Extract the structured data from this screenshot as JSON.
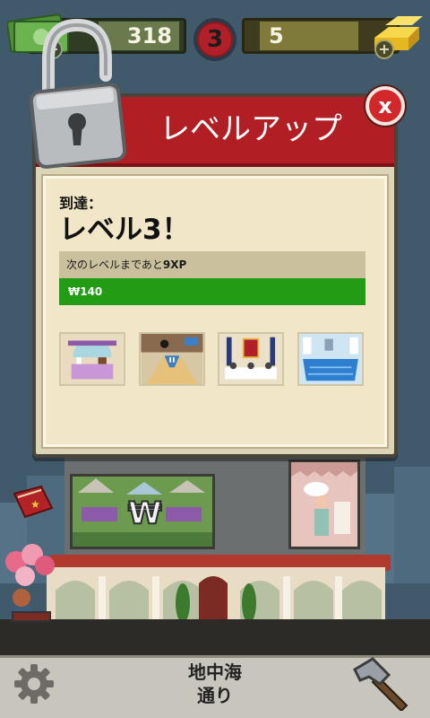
{
  "hud": {
    "money": "318",
    "level": "3",
    "gold": "5",
    "plus_symbol": "+"
  },
  "modal": {
    "title": "レベルアップ",
    "close_symbol": "x",
    "reached_label": "到達：",
    "level_text": "レベル3！",
    "xp_prefix": "次のレベルまであと",
    "xp_value": "9XP",
    "reward": "₩140",
    "unlocks": [
      "cake-shop",
      "bowling-alley",
      "dining-hall",
      "swimming-pool"
    ]
  },
  "footer": {
    "street_line1": "地中海",
    "street_line2": "通り"
  },
  "icons": [
    "padlock-icon",
    "money-icon",
    "gold-bars-icon",
    "gear-icon",
    "hammer-icon",
    "book-icon",
    "balloons-icon"
  ],
  "colors": {
    "header_red": "#b11f24",
    "reward_green": "#229b15",
    "panel_bg": "#f1e7c8"
  }
}
